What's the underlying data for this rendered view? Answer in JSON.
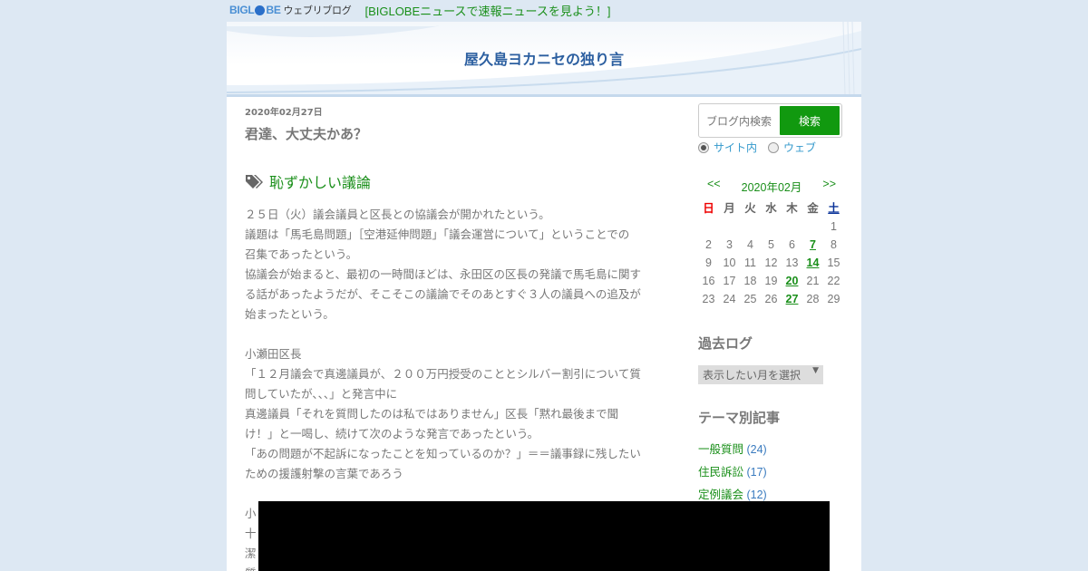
{
  "topbar": {
    "logo_prefix": "BIGL",
    "logo_suffix": "BE",
    "logo_sub": "ウェブリブログ",
    "news_link": "[BIGLOBEニュースで速報ニュースを見よう！]"
  },
  "blog": {
    "title": "屋久島ヨカニセの独り言"
  },
  "post": {
    "date": "2020年02月27日",
    "title": "君達、大丈夫かあ？",
    "category": "恥ずかしい議論",
    "lines": [
      "２５日（火）議会議員と区長との協議会が開かれたという。",
      "議題は「馬毛島問題」［空港延伸問題」「議会運営について」ということでの",
      "召集であったという。",
      "協議会が始まると、最初の一時間ほどは、永田区の区長の発議で馬毛島に関す",
      "る話があったようだが、そこそこの議論でそのあとすぐ３人の議員への追及が",
      "始まったという。",
      "",
      "小瀬田区長",
      "「１２月議会で真邊議員が、２００万円授受のこととシルバー割引について質",
      "問していたが、、、」と発言中に",
      "真邊議員「それを質問したのは私ではありません」区長「黙れ最後まで聞",
      "け！」と一喝し、続けて次のような発言であったという。",
      "「あの問題が不起訴になったことを知っているのか？」＝＝議事録に残したい",
      "ための援護射撃の言葉であろう",
      "",
      "小",
      "十",
      "潔",
      "質"
    ]
  },
  "search": {
    "placeholder": "ブログ内検索",
    "button": "検索",
    "option_site": "サイト内",
    "option_web": "ウェブ"
  },
  "calendar": {
    "prev": "<<",
    "month": "2020年02月",
    "next": ">>",
    "weekdays": [
      "日",
      "月",
      "火",
      "水",
      "木",
      "金",
      "土"
    ],
    "days": [
      [
        "",
        "",
        "",
        "",
        "",
        "",
        "1"
      ],
      [
        "2",
        "3",
        "4",
        "5",
        "6",
        "7",
        "8"
      ],
      [
        "9",
        "10",
        "11",
        "12",
        "13",
        "14",
        "15"
      ],
      [
        "16",
        "17",
        "18",
        "19",
        "20",
        "21",
        "22"
      ],
      [
        "23",
        "24",
        "25",
        "26",
        "27",
        "28",
        "29"
      ]
    ],
    "linked_days": [
      "7",
      "14",
      "20",
      "27"
    ]
  },
  "archive": {
    "heading": "過去ログ",
    "select_label": "表示したい月を選択"
  },
  "themes": {
    "heading": "テーマ別記事",
    "items": [
      {
        "name": "一般質問",
        "count": "(24)"
      },
      {
        "name": "住民訴訟",
        "count": "(17)"
      },
      {
        "name": "定例議会",
        "count": "(12)"
      }
    ]
  },
  "colors": {
    "link_green": "#1a8f1a",
    "search_button": "#11990f",
    "title_blue": "#2c5fa0",
    "background": "#dde8f3"
  }
}
